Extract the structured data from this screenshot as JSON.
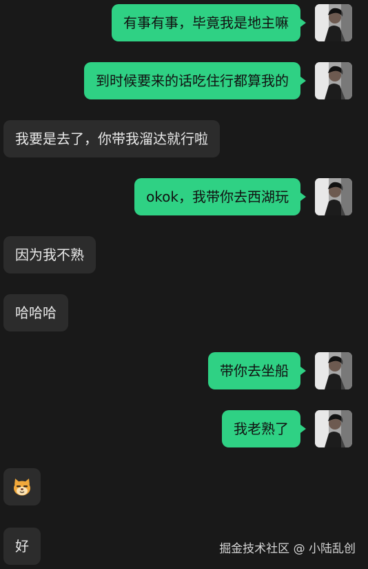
{
  "messages": [
    {
      "side": "me",
      "text": "有事有事，毕竟我是地主嘛"
    },
    {
      "side": "me",
      "text": "到时候要来的话吃住行都算我的"
    },
    {
      "side": "them",
      "text": "我要是去了，你带我溜达就行啦"
    },
    {
      "side": "me",
      "text": "okok，我带你去西湖玩"
    },
    {
      "side": "them",
      "text": "因为我不熟"
    },
    {
      "side": "them",
      "text": "哈哈哈"
    },
    {
      "side": "me",
      "text": "带你去坐船"
    },
    {
      "side": "me",
      "text": "我老熟了"
    },
    {
      "side": "them",
      "emoji": "cat-face-emoji"
    },
    {
      "side": "them",
      "text": "好"
    }
  ],
  "watermark": "掘金技术社区 @ 小陆乱创",
  "colors": {
    "background": "#191919",
    "my_bubble": "#2fd184",
    "their_bubble": "#2c2c2c"
  }
}
